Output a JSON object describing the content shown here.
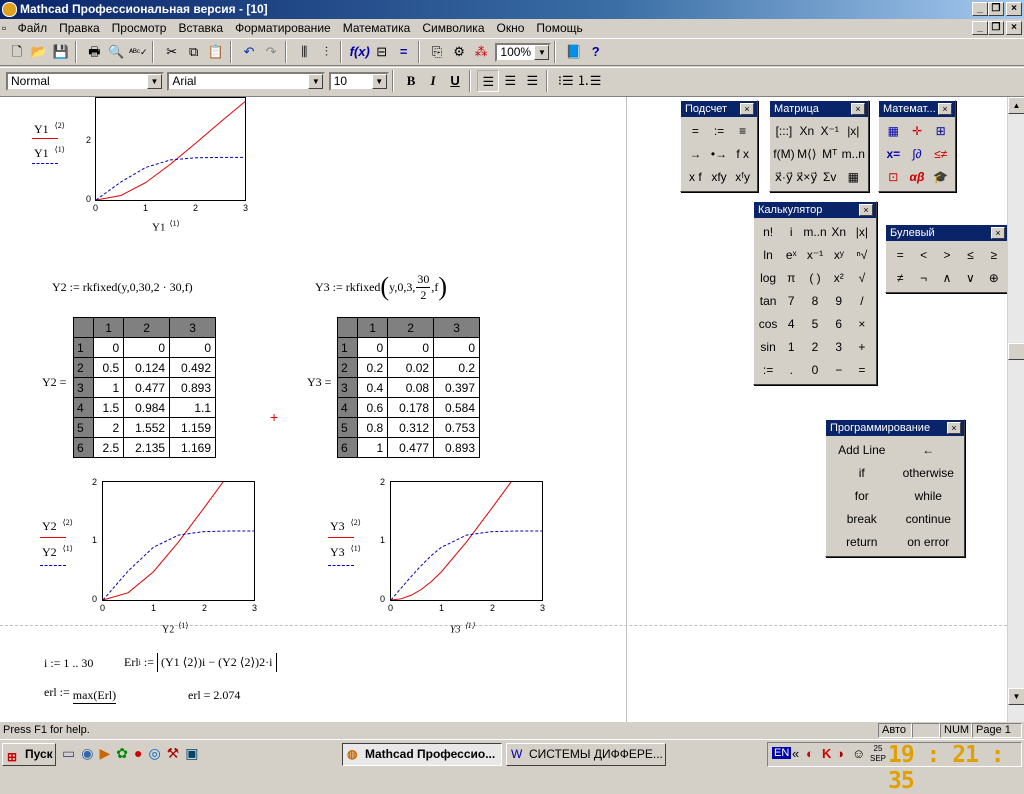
{
  "window": {
    "title": "Mathcad Профессиональная версия - [10]"
  },
  "menu": [
    "Файл",
    "Правка",
    "Просмотр",
    "Вставка",
    "Форматирование",
    "Математика",
    "Символика",
    "Окно",
    "Помощь"
  ],
  "toolbar": {
    "zoom": "100%"
  },
  "format": {
    "style": "Normal",
    "font": "Arial",
    "size": "10"
  },
  "doc": {
    "plot0": {
      "leg1": "Y1",
      "leg1sup": "⟨2⟩",
      "leg2": "Y1",
      "leg2sup": "⟨1⟩",
      "xlab": "Y1",
      "xlabsup": "⟨1⟩",
      "yticks": [
        "2",
        "0"
      ],
      "xticks": [
        "0",
        "1",
        "2",
        "3"
      ]
    },
    "eq_y2": "Y2 := rkfixed(y,0,30,2 · 30,f)",
    "eq_y3_pre": "Y3 := rkfixed",
    "eq_y3_args": "y,0,3,",
    "eq_y3_num": "30",
    "eq_y3_den": "2",
    "eq_y3_end": ",f",
    "y2": {
      "label": "Y2 =",
      "cols": [
        "1",
        "2",
        "3"
      ],
      "rows": [
        [
          "1",
          "0",
          "0",
          "0"
        ],
        [
          "2",
          "0.5",
          "0.124",
          "0.492"
        ],
        [
          "3",
          "1",
          "0.477",
          "0.893"
        ],
        [
          "4",
          "1.5",
          "0.984",
          "1.1"
        ],
        [
          "5",
          "2",
          "1.552",
          "1.159"
        ],
        [
          "6",
          "2.5",
          "2.135",
          "1.169"
        ]
      ]
    },
    "y3": {
      "label": "Y3 =",
      "cols": [
        "1",
        "2",
        "3"
      ],
      "rows": [
        [
          "1",
          "0",
          "0",
          "0"
        ],
        [
          "2",
          "0.2",
          "0.02",
          "0.2"
        ],
        [
          "3",
          "0.4",
          "0.08",
          "0.397"
        ],
        [
          "4",
          "0.6",
          "0.178",
          "0.584"
        ],
        [
          "5",
          "0.8",
          "0.312",
          "0.753"
        ],
        [
          "6",
          "1",
          "0.477",
          "0.893"
        ]
      ]
    },
    "plot1": {
      "leg1": "Y2",
      "leg2": "Y2",
      "xlab": "Y2",
      "sup2": "⟨2⟩",
      "sup1": "⟨1⟩",
      "yticks": [
        "2",
        "1",
        "0"
      ],
      "xticks": [
        "0",
        "1",
        "2",
        "3"
      ]
    },
    "plot2": {
      "leg1": "Y3",
      "leg2": "Y3",
      "xlab": "Y3",
      "sup2": "⟨2⟩",
      "sup1": "⟨1⟩",
      "yticks": [
        "2",
        "1",
        "0"
      ],
      "xticks": [
        "0",
        "1",
        "2",
        "3"
      ]
    },
    "eq_i": "i := 1 .. 30",
    "eq_er1_lhs": "Erl",
    "eq_er1_sub": "i",
    "eq_er1_body": "(Y1 ⟨2⟩)i − (Y2 ⟨2⟩)2·i",
    "eq_er1max_lhs": "erl :=",
    "eq_er1max_num": "max(Erl)",
    "eq_er1_res": "erl = 2.074"
  },
  "palettes": {
    "podschet": {
      "title": "Подсчет",
      "items": [
        "=",
        ":=",
        "≡",
        "→",
        "•→",
        "f x",
        "x f",
        "xfy",
        "xᶠy"
      ]
    },
    "matrica": {
      "title": "Матрица",
      "items": [
        "[:::]",
        "Xn",
        "X⁻¹",
        "|x|",
        "f(M)",
        "M⟨⟩",
        "Mᵀ",
        "m..n",
        "x⃗·y⃗",
        "x⃗×y⃗",
        "Σv",
        "▦"
      ]
    },
    "matemat": {
      "title": "Математ..."
    },
    "calc": {
      "title": "Калькулятор",
      "items": [
        "n!",
        "i",
        "m..n",
        "Xn",
        "|x|",
        "ln",
        "eˣ",
        "x⁻¹",
        "xʸ",
        "ⁿ√",
        "log",
        "π",
        "( )",
        "x²",
        "√",
        "tan",
        "7",
        "8",
        "9",
        "/",
        "cos",
        "4",
        "5",
        "6",
        "×",
        "sin",
        "1",
        "2",
        "3",
        "+",
        ":=",
        ".",
        "0",
        "−",
        "="
      ]
    },
    "bool": {
      "title": "Булевый",
      "items": [
        "=",
        "<",
        ">",
        "≤",
        "≥",
        "≠",
        "¬",
        "∧",
        "∨",
        "⊕"
      ]
    },
    "prog": {
      "title": "Программирование",
      "items": [
        "Add Line",
        "←",
        "if",
        "otherwise",
        "for",
        "while",
        "break",
        "continue",
        "return",
        "on error"
      ]
    }
  },
  "status": {
    "help": "Press F1 for help.",
    "mode": "Авто",
    "num": "NUM",
    "page": "Page 1"
  },
  "taskbar": {
    "start": "Пуск",
    "task1": "Mathcad Профессио...",
    "task2": "СИСТЕМЫ ДИФФЕРЕ...",
    "lang": "EN",
    "date_day": "25",
    "date_mon": "SEP",
    "time": "19 : 21 : 35"
  },
  "chart_data": [
    {
      "type": "line",
      "series": [
        {
          "name": "Y1⟨2⟩",
          "x": [
            0,
            0.5,
            1,
            1.5,
            2,
            2.5,
            3
          ],
          "y": [
            0,
            0.124,
            0.477,
            0.984,
            1.552,
            2.135,
            2.7
          ]
        },
        {
          "name": "Y1⟨1⟩",
          "x": [
            0,
            0.5,
            1,
            1.5,
            2,
            2.5,
            3
          ],
          "y": [
            0,
            0.492,
            0.893,
            1.1,
            1.159,
            1.169,
            1.17
          ]
        }
      ],
      "xlim": [
        0,
        3
      ],
      "ylim": [
        0,
        2.8
      ]
    },
    {
      "type": "line",
      "series": [
        {
          "name": "Y2⟨2⟩",
          "x": [
            0,
            0.5,
            1,
            1.5,
            2,
            2.5,
            3
          ],
          "y": [
            0,
            0.124,
            0.477,
            0.984,
            1.552,
            2.135,
            2.7
          ]
        },
        {
          "name": "Y2⟨1⟩",
          "x": [
            0,
            0.5,
            1,
            1.5,
            2,
            2.5,
            3
          ],
          "y": [
            0,
            0.492,
            0.893,
            1.1,
            1.159,
            1.169,
            1.17
          ]
        }
      ],
      "xlim": [
        0,
        3
      ],
      "ylim": [
        0,
        2
      ]
    },
    {
      "type": "line",
      "series": [
        {
          "name": "Y3⟨2⟩",
          "x": [
            0,
            0.2,
            0.4,
            0.6,
            0.8,
            1,
            1.5,
            2,
            2.5,
            3
          ],
          "y": [
            0,
            0.02,
            0.08,
            0.178,
            0.312,
            0.477,
            0.984,
            1.552,
            2.135,
            2.7
          ]
        },
        {
          "name": "Y3⟨1⟩",
          "x": [
            0,
            0.2,
            0.4,
            0.6,
            0.8,
            1,
            1.5,
            2,
            2.5,
            3
          ],
          "y": [
            0,
            0.2,
            0.397,
            0.584,
            0.753,
            0.893,
            1.1,
            1.159,
            1.169,
            1.17
          ]
        }
      ],
      "xlim": [
        0,
        3
      ],
      "ylim": [
        0,
        2
      ]
    }
  ]
}
